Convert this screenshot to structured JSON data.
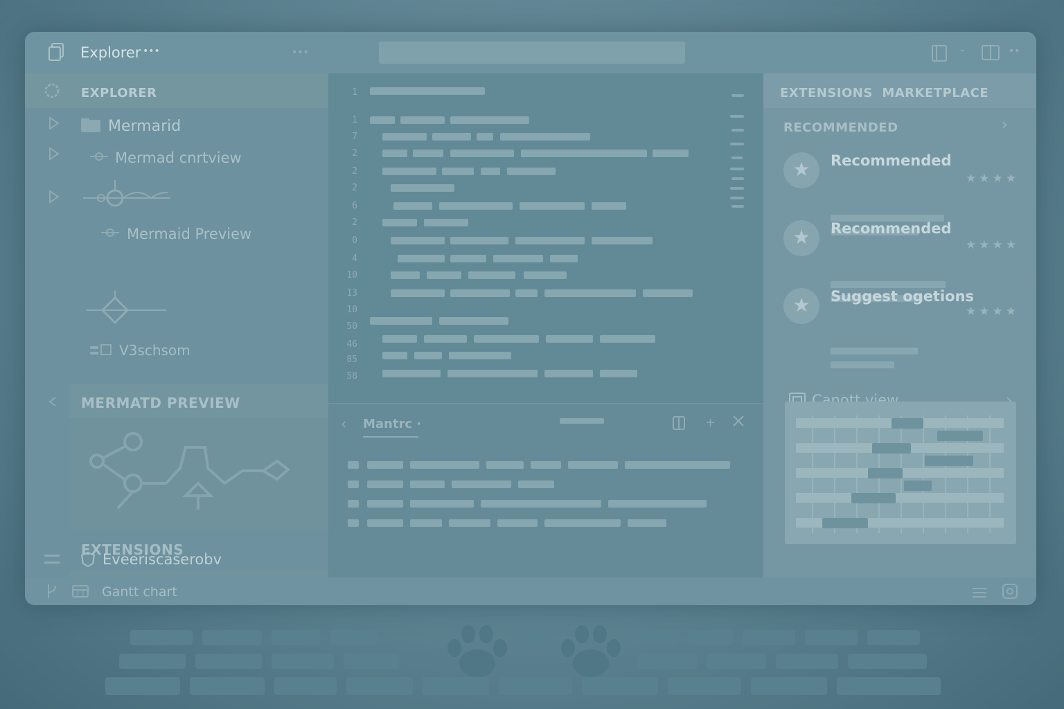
{
  "window": {
    "title": "Explorer",
    "title_dots": "•••",
    "header_dots": "•••"
  },
  "sidebar": {
    "explorer_heading": "EXPLORER",
    "items": [
      {
        "label": "Mermarid"
      },
      {
        "label": "Mermad cnrtview"
      },
      {
        "label": "Mermaid Preview"
      },
      {
        "label": "V3schsom"
      }
    ],
    "preview_heading": "MERMATD PREVIEW",
    "extensions_heading": "EXTENSIONS",
    "extension_item": "Eveeriscaserobv"
  },
  "editor": {
    "line_numbers": [
      "1",
      "1",
      "7",
      "2",
      "2",
      "2",
      "6",
      "2",
      "0",
      "4",
      "10",
      "13",
      "10",
      "50",
      "46",
      "85",
      "58"
    ],
    "panel_tab": "Mantrc ·"
  },
  "right_pane": {
    "heading": "EXTENSIONS  MARKETPLACE",
    "recommended_heading": "RECOMMENDED",
    "cards": [
      {
        "title": "Recommended",
        "rating": "★★★★"
      },
      {
        "title": "Recommended",
        "rating": "★★★★"
      },
      {
        "title": "Suggest ogetions",
        "rating": "★★★★"
      }
    ],
    "gantt_label": "Canott view"
  },
  "statusbar": {
    "label": "Gantt chart"
  },
  "colors": {
    "background": "#5d8391",
    "window": "#6a8f9c",
    "editor": "#628996",
    "accent": "#86a6b0"
  },
  "icons": [
    "files-icon",
    "settings-icon",
    "chevron-right-icon",
    "folder-icon",
    "split-editor-icon",
    "layout-icon",
    "star-icon",
    "close-icon",
    "pin-icon",
    "gantt-icon",
    "branch-icon",
    "calendar-icon",
    "bell-icon",
    "paw-icon"
  ]
}
